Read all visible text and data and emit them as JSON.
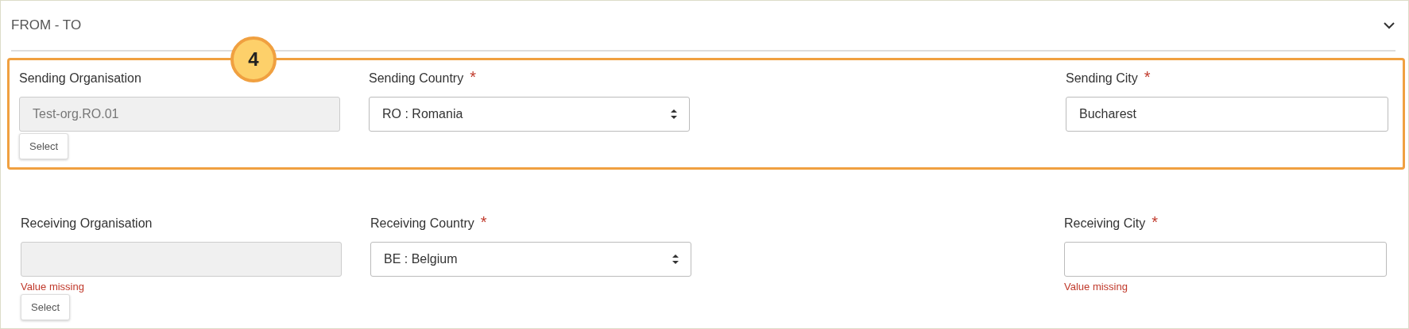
{
  "section": {
    "title": "FROM - TO",
    "expanded": true
  },
  "groups": [
    {
      "highlighted": true,
      "callout": "4",
      "fields": [
        {
          "kind": "organisation",
          "label": "Sending Organisation",
          "value": "Test-org.RO.01",
          "disabled": true,
          "button": "Select"
        },
        {
          "kind": "dropdown",
          "label": "Sending Country",
          "required_mark": "*",
          "value": "RO : Romania"
        },
        {
          "kind": "text",
          "label": "Sending City",
          "required_mark": "*",
          "value": "Bucharest"
        }
      ]
    },
    {
      "fields": [
        {
          "kind": "organisation",
          "label": "Receiving Organisation",
          "disabled": true,
          "error": "Value missing",
          "button": "Select"
        },
        {
          "kind": "dropdown",
          "label": "Receiving Country",
          "required_mark": "*",
          "value": "BE : Belgium"
        },
        {
          "kind": "text",
          "label": "Receiving City",
          "required_mark": "*",
          "error": "Value missing"
        }
      ]
    }
  ]
}
